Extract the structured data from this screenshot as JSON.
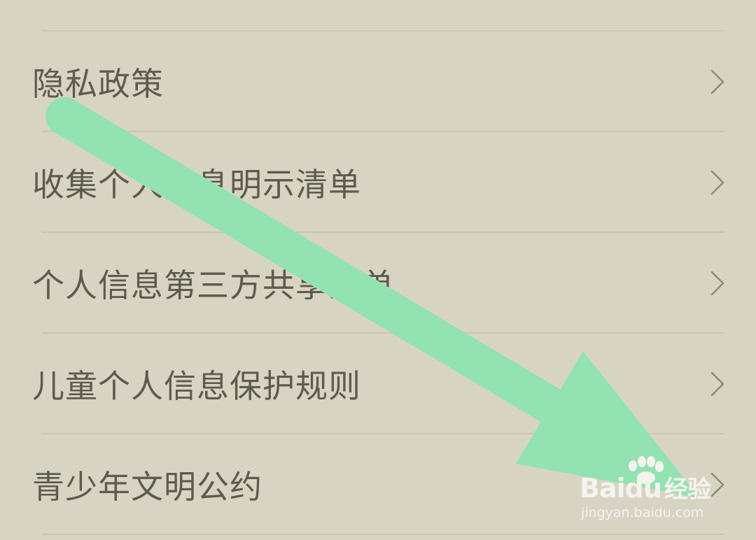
{
  "menu": {
    "items": [
      {
        "label": "隐私政策",
        "icon": "chevron-right-icon"
      },
      {
        "label": "收集个人信息明示清单",
        "icon": "chevron-right-icon"
      },
      {
        "label": "个人信息第三方共享清单",
        "icon": "chevron-right-icon"
      },
      {
        "label": "儿童个人信息保护规则",
        "icon": "chevron-right-icon"
      },
      {
        "label": "青少年文明公约",
        "icon": "chevron-right-icon"
      }
    ]
  },
  "annotation": {
    "shape": "arrow-icon",
    "color": "#93e2b1"
  },
  "watermark": {
    "brand": "Baidu",
    "brand_cn": "经验",
    "url": "jingyan.baidu.com",
    "icon": "paw-icon"
  },
  "colors": {
    "background": "#d8d4c3",
    "divider": "#c9c5b4",
    "text": "#5d5b4e",
    "chevron": "#8d8a7b"
  }
}
